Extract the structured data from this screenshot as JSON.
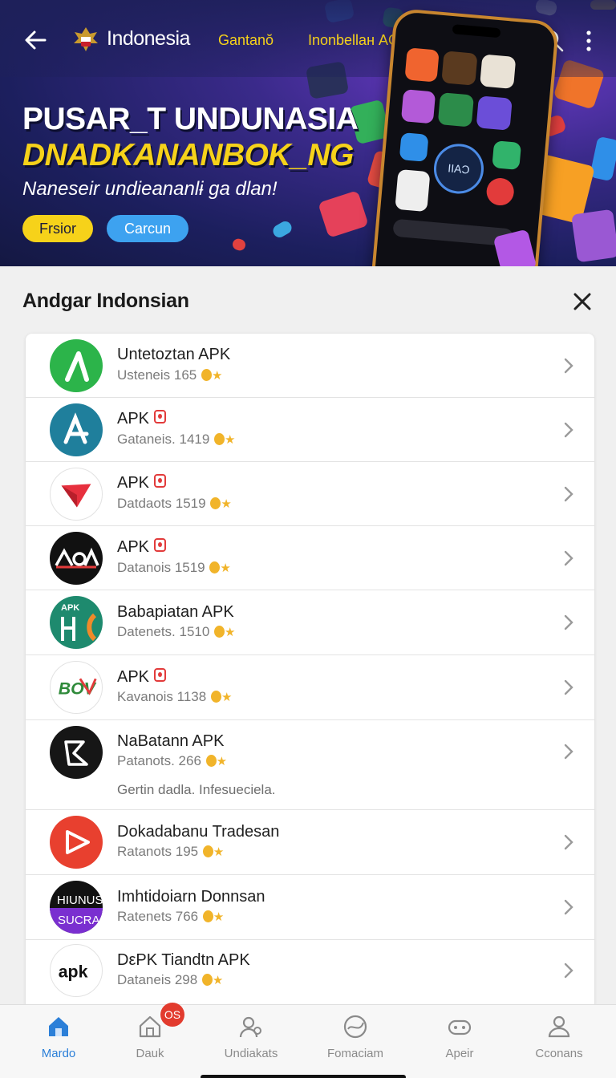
{
  "header": {
    "title": "Indonesia",
    "link1": "Gantanŏ",
    "link2": "Inonbellaн AOƂN",
    "icons": [
      "back-arrow-icon",
      "emblem-icon",
      "search-icon",
      "more-vertical-icon"
    ]
  },
  "banner": {
    "headline1": "PUSAR_T UNDUNASIA",
    "headline2": "DNADKANANBOK_NG",
    "subtitle": "Naneseir undieananlɨ ga dlan!",
    "button_primary": "Frsior",
    "button_secondary": "Carcun",
    "phone_circle_label": "IIAƆ",
    "colors": {
      "accent_yellow": "#f6d21a",
      "accent_blue": "#3da2f0",
      "bg_dark": "#1c1f5e"
    }
  },
  "section": {
    "title": "Andgar Indonsian"
  },
  "apps": [
    {
      "name": "Untetoztan APK",
      "meta": "Usteneis 165",
      "icon": "green-lambda-icon",
      "badge": false
    },
    {
      "name": "APK",
      "meta": "Gataneis. 1419",
      "icon": "teal-a-icon",
      "badge": true
    },
    {
      "name": "APK",
      "meta": "Datdaots 1519",
      "icon": "red-paper-plane-icon",
      "badge": true
    },
    {
      "name": "APK",
      "meta": "Datanois 1519",
      "icon": "black-aoa-logo-icon",
      "badge": true
    },
    {
      "name": "Babapiatan APK",
      "meta": "Datenets. 1510",
      "icon": "teal-apk-logo-icon",
      "badge": false
    },
    {
      "name": "APK",
      "meta": "Kavanois 1138",
      "icon": "bov-logo-icon",
      "badge": true
    },
    {
      "name": "NaBatann APK",
      "meta": "Patanots. 266",
      "icon": "black-arrow-logo-icon",
      "badge": false,
      "note": "Gertin dadla. Infesueciela."
    },
    {
      "name": "Dokadabanu Tradesan",
      "meta": "Ratanots 195",
      "icon": "red-play-icon",
      "badge": false
    },
    {
      "name": "Imhtidoiarn Donnsan",
      "meta": "Ratenets 766",
      "icon": "hiunus-sucra-logo-icon",
      "badge": false
    },
    {
      "name": "DεPK Tiandtn APK",
      "meta": "Dataneis 298",
      "icon": "apk-text-logo-icon",
      "badge": false
    }
  ],
  "bottom_nav": {
    "items": [
      {
        "label": "Mardo",
        "icon": "home-icon",
        "active": true
      },
      {
        "label": "Dauk",
        "icon": "house-outline-icon",
        "active": false
      },
      {
        "label": "Undiakats",
        "icon": "people-icon",
        "active": false
      },
      {
        "label": "Fomaciam",
        "icon": "globe-icon",
        "active": false
      },
      {
        "label": "Apeir",
        "icon": "gamepad-icon",
        "active": false
      },
      {
        "label": "Cconans",
        "icon": "profile-icon",
        "active": false
      }
    ],
    "badge": "OS"
  }
}
